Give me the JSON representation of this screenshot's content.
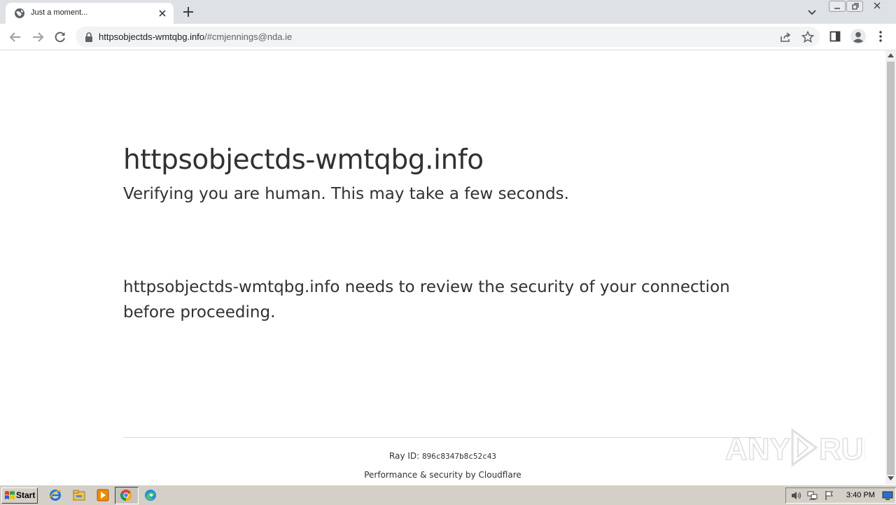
{
  "browser": {
    "tab": {
      "title": "Just a moment..."
    },
    "address_bar": {
      "host": "httpsobjectds-wmtqbg.info",
      "path": "/#cmjennings@nda.ie"
    }
  },
  "page": {
    "site_title": "httpsobjectds-wmtqbg.info",
    "subtitle": "Verifying you are human. This may take a few seconds.",
    "review_message": "httpsobjectds-wmtqbg.info needs to review the security of your connection before proceeding.",
    "ray_label": "Ray ID: ",
    "ray_id": "896c8347b8c52c43",
    "footer": "Performance & security by Cloudflare",
    "watermark": "ANY RUN"
  },
  "taskbar": {
    "start_label": "Start",
    "pinned_icons": [
      "internet-explorer-icon",
      "file-explorer-icon",
      "media-player-icon",
      "chrome-icon",
      "edge-icon"
    ],
    "tray_icons": [
      "volume-icon",
      "network-icon",
      "flag-icon",
      "monitor-icon"
    ],
    "clock": "3:40 PM"
  },
  "colors": {
    "tab_strip": "#dee1e6",
    "omnibox": "#f1f3f4",
    "text": "#313131",
    "taskbar": "#d4d0c8"
  }
}
